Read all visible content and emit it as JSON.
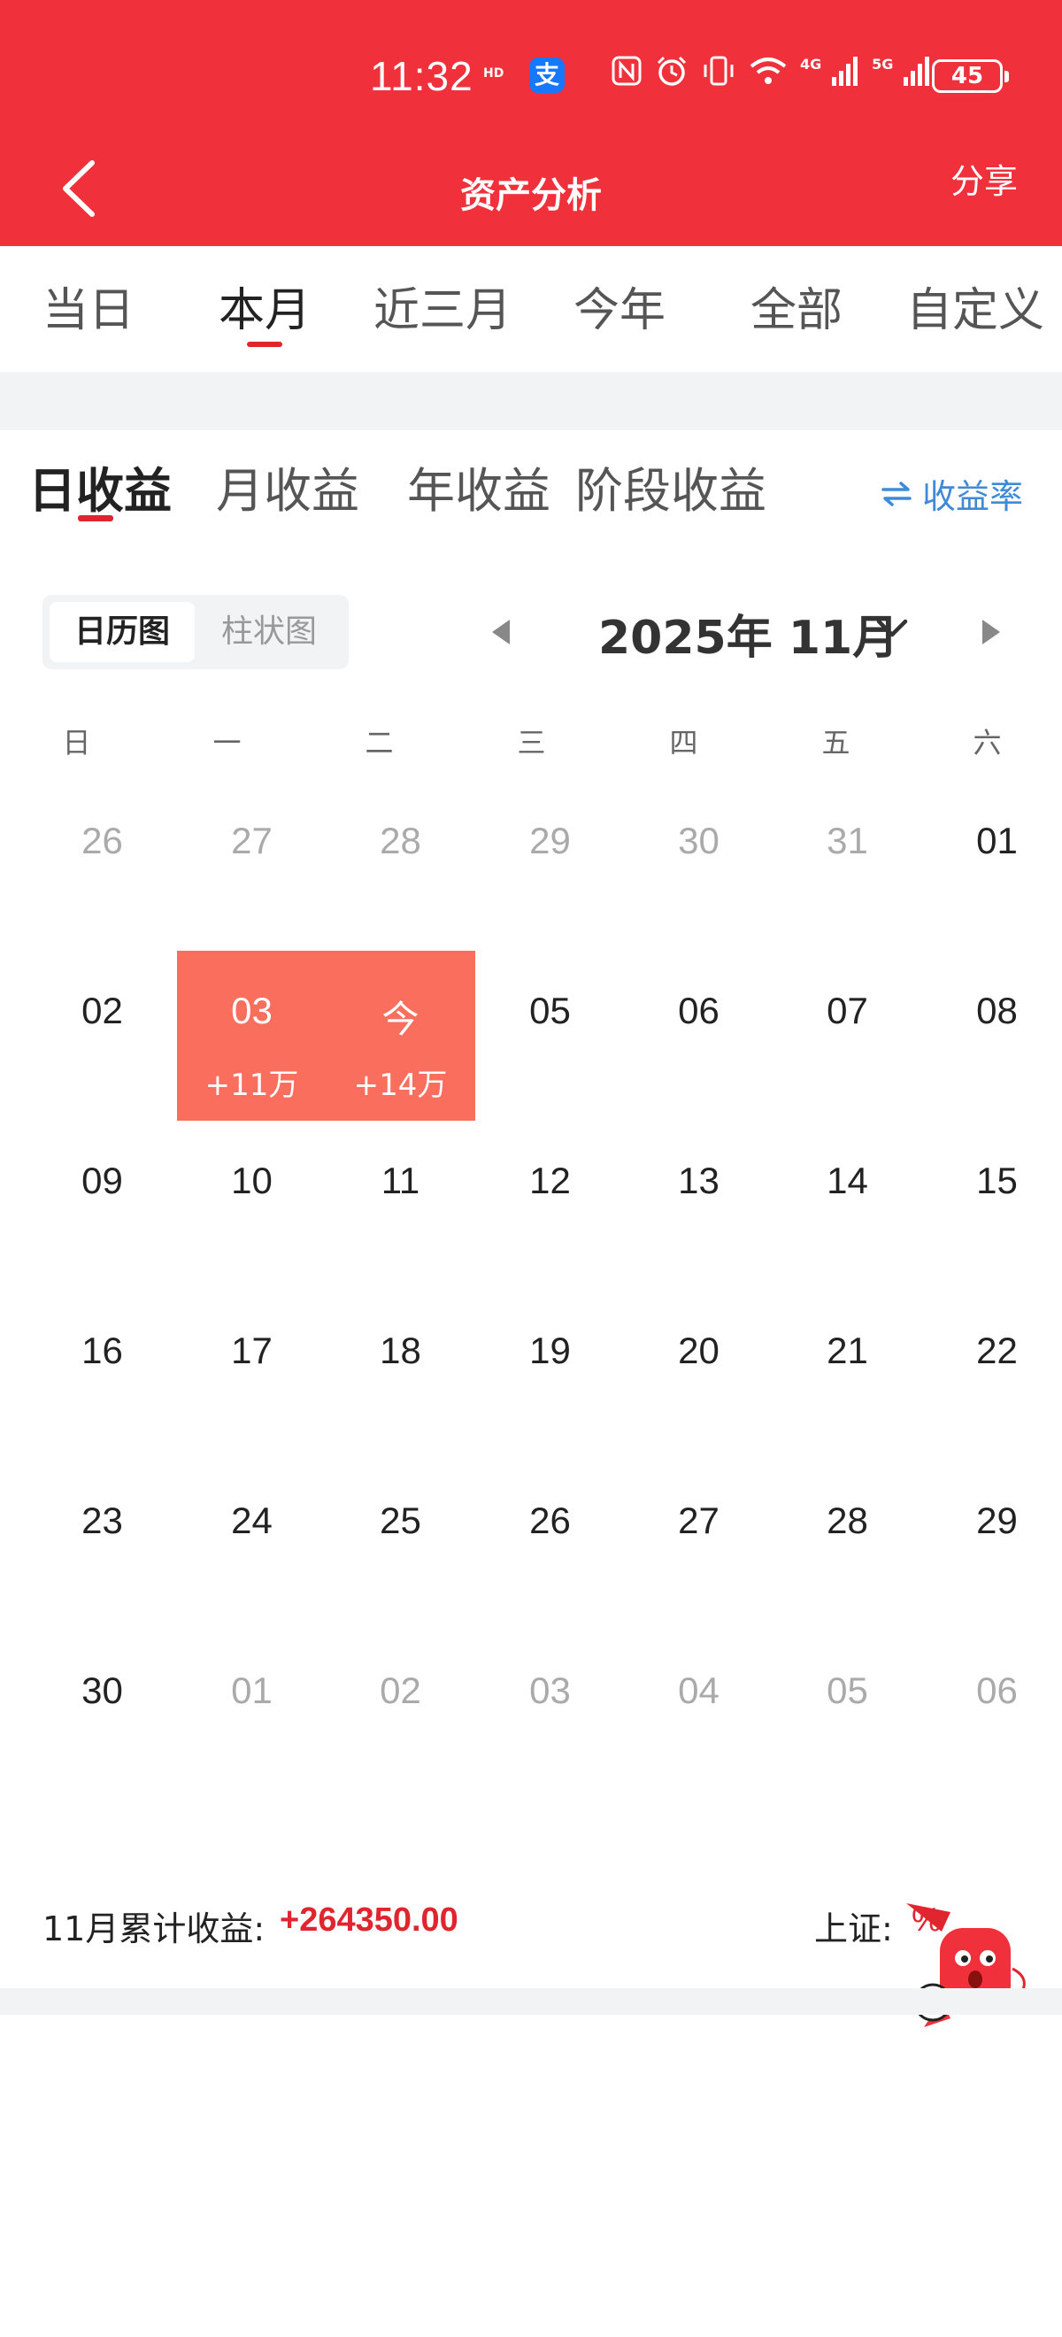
{
  "status_bar": {
    "time": "11:32",
    "hd_label": "HD",
    "net_4g": "4G",
    "net_5g": "5G",
    "battery": "45"
  },
  "nav": {
    "title": "资产分析",
    "share": "分享"
  },
  "period_tabs": [
    "当日",
    "本月",
    "近三月",
    "今年",
    "全部",
    "自定义"
  ],
  "period_active_index": 1,
  "income_tabs": [
    "日收益",
    "月收益",
    "年收益",
    "阶段收益"
  ],
  "income_active_index": 0,
  "rate_toggle": {
    "label": "收益率",
    "icon": "swap-arrows-icon"
  },
  "view_switch": {
    "calendar": "日历图",
    "bar": "柱状图",
    "active": "calendar"
  },
  "month_selector": {
    "label": "2025年 11月"
  },
  "weekdays": [
    "日",
    "一",
    "二",
    "三",
    "四",
    "五",
    "六"
  ],
  "calendar_rows": [
    [
      {
        "d": "26",
        "other": true
      },
      {
        "d": "27",
        "other": true
      },
      {
        "d": "28",
        "other": true
      },
      {
        "d": "29",
        "other": true
      },
      {
        "d": "30",
        "other": true
      },
      {
        "d": "31",
        "other": true
      },
      {
        "d": "01"
      }
    ],
    [
      {
        "d": "02"
      },
      {
        "d": "03",
        "amount": "+11万",
        "highlight": true
      },
      {
        "d": "今",
        "amount": "+14万",
        "highlight": true
      },
      {
        "d": "05"
      },
      {
        "d": "06"
      },
      {
        "d": "07"
      },
      {
        "d": "08"
      }
    ],
    [
      {
        "d": "09"
      },
      {
        "d": "10"
      },
      {
        "d": "11"
      },
      {
        "d": "12"
      },
      {
        "d": "13"
      },
      {
        "d": "14"
      },
      {
        "d": "15"
      }
    ],
    [
      {
        "d": "16"
      },
      {
        "d": "17"
      },
      {
        "d": "18"
      },
      {
        "d": "19"
      },
      {
        "d": "20"
      },
      {
        "d": "21"
      },
      {
        "d": "22"
      }
    ],
    [
      {
        "d": "23"
      },
      {
        "d": "24"
      },
      {
        "d": "25"
      },
      {
        "d": "26"
      },
      {
        "d": "27"
      },
      {
        "d": "28"
      },
      {
        "d": "29"
      }
    ],
    [
      {
        "d": "30"
      },
      {
        "d": "01",
        "other": true
      },
      {
        "d": "02",
        "other": true
      },
      {
        "d": "03",
        "other": true
      },
      {
        "d": "04",
        "other": true
      },
      {
        "d": "05",
        "other": true
      },
      {
        "d": "06",
        "other": true
      }
    ]
  ],
  "summary": {
    "label": "11月累计收益:",
    "value": "+264350.00",
    "index_label": "上证:",
    "index_value": "%"
  },
  "colors": {
    "brand_red": "#f0303a",
    "highlight": "#fa6e5d",
    "accent_blue": "#3f8ad8",
    "profit_red": "#e1252f"
  }
}
